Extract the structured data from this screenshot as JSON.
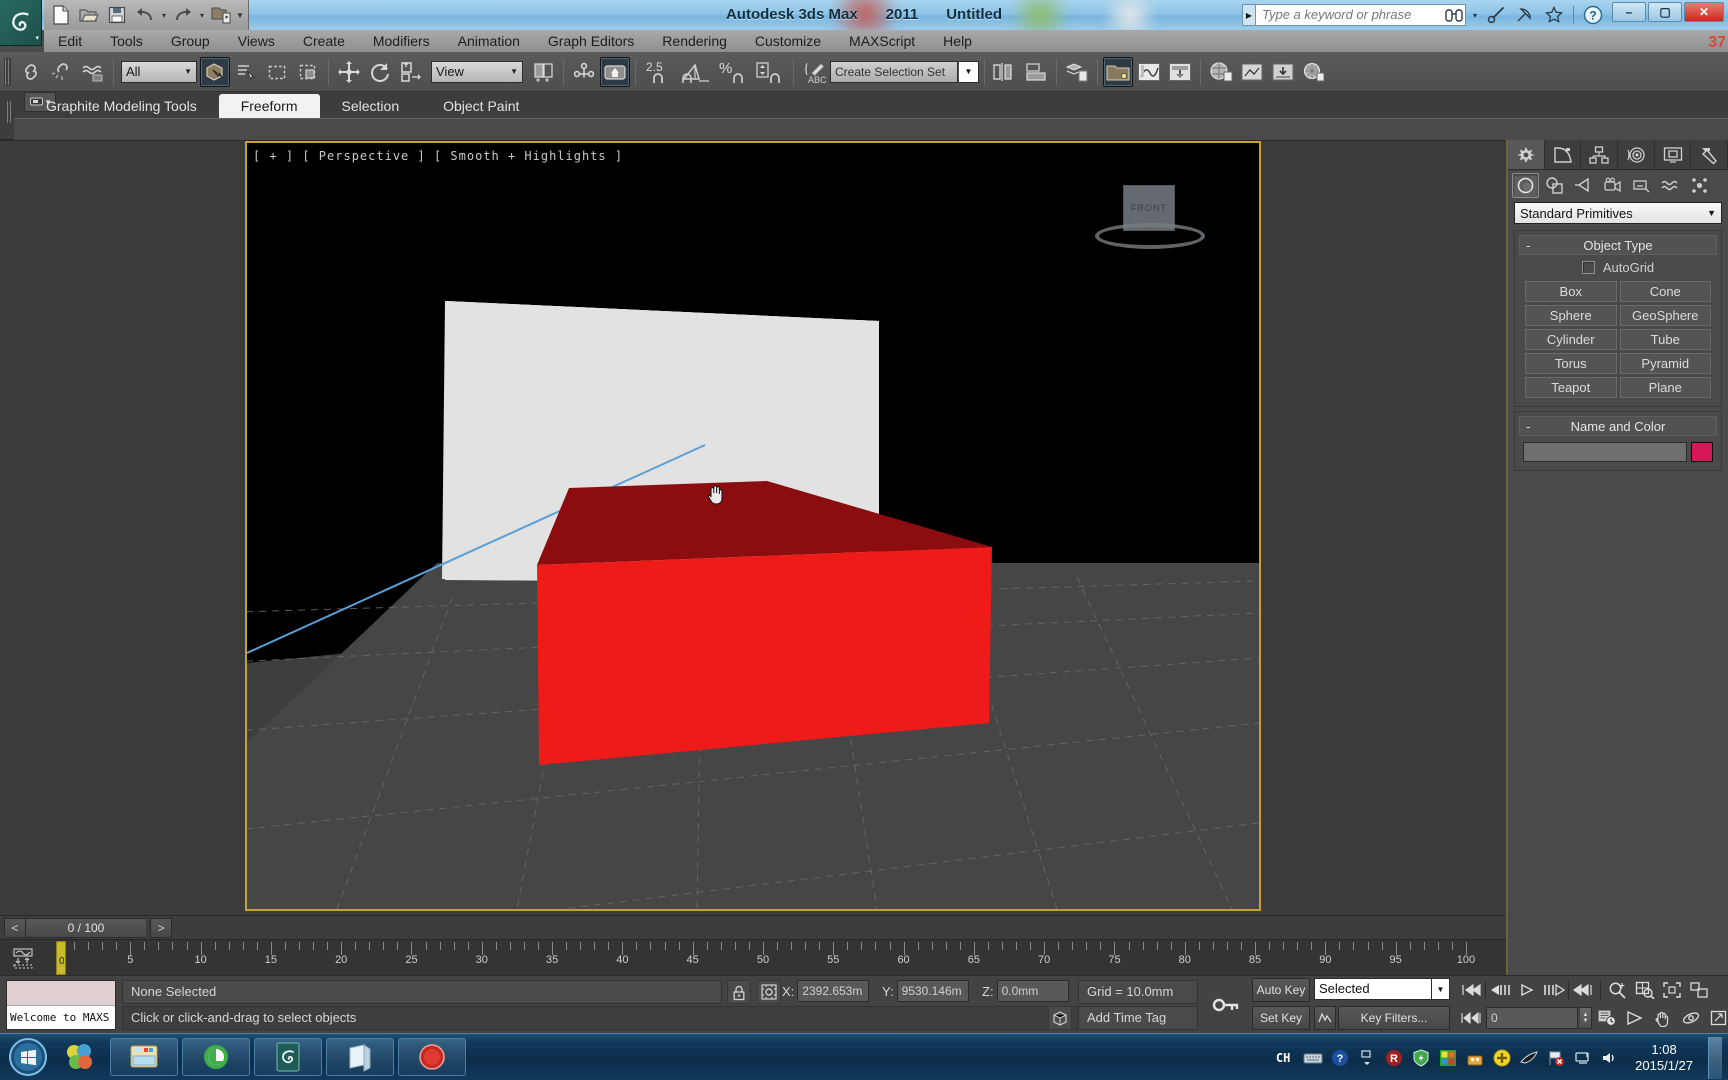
{
  "window": {
    "app_name": "Autodesk 3ds Max",
    "version": "2011",
    "document": "Untitled",
    "minimize_label": "–",
    "maximize_label": "▢",
    "close_label": "✕"
  },
  "quick_access": {
    "items": [
      {
        "name": "new-file-icon",
        "label": "New"
      },
      {
        "name": "open-file-icon",
        "label": "Open"
      },
      {
        "name": "save-file-icon",
        "label": "Save"
      },
      {
        "name": "undo-icon",
        "label": "Undo"
      },
      {
        "name": "undo-dropdown-icon",
        "label": "▾"
      },
      {
        "name": "redo-icon",
        "label": "Redo"
      },
      {
        "name": "redo-dropdown-icon",
        "label": "▾"
      },
      {
        "name": "project-folder-icon",
        "label": "Set Project Folder"
      },
      {
        "name": "qat-customize-icon",
        "label": "▾"
      }
    ]
  },
  "search": {
    "placeholder": "Type a keyword or phrase",
    "expand_label": "▶"
  },
  "title_icons": [
    {
      "name": "binoculars-icon",
      "label": "Search"
    },
    {
      "name": "binoculars-dropdown-icon",
      "label": "▾"
    },
    {
      "name": "key-wrench-icon",
      "label": "Subscription"
    },
    {
      "name": "satellite-dish-icon",
      "label": "Communication Center"
    },
    {
      "name": "favorites-star-icon",
      "label": "Favorites"
    },
    {
      "name": "help-question-icon",
      "label": "Help"
    }
  ],
  "menubar": {
    "items": [
      {
        "label": "Edit"
      },
      {
        "label": "Tools"
      },
      {
        "label": "Group"
      },
      {
        "label": "Views"
      },
      {
        "label": "Create"
      },
      {
        "label": "Modifiers"
      },
      {
        "label": "Animation"
      },
      {
        "label": "Graph Editors"
      },
      {
        "label": "Rendering"
      },
      {
        "label": "Customize"
      },
      {
        "label": "MAXScript"
      },
      {
        "label": "Help"
      }
    ]
  },
  "toolbar": {
    "selection_filter": "All",
    "reference_coord_system": "View",
    "named_selection_set": "Create Selection Set",
    "snap_angle": "2.5",
    "buttons": [
      {
        "name": "select-and-link-icon",
        "label": "Select and Link",
        "active": false
      },
      {
        "name": "unlink-selection-icon",
        "label": "Unlink Selection",
        "active": false
      },
      {
        "name": "bind-to-space-warp-icon",
        "label": "Bind to Space Warp",
        "active": false
      },
      {
        "name": "select-object-icon",
        "label": "Select Object",
        "active": true
      },
      {
        "name": "select-by-name-icon",
        "label": "Select by Name",
        "active": false
      },
      {
        "name": "rectangular-selection-region-icon",
        "label": "Rectangular Selection Region",
        "active": false
      },
      {
        "name": "window-crossing-icon",
        "label": "Window / Crossing",
        "active": false
      },
      {
        "name": "select-and-move-icon",
        "label": "Select and Move",
        "active": false
      },
      {
        "name": "select-and-rotate-icon",
        "label": "Select and Rotate",
        "active": false
      },
      {
        "name": "select-and-scale-icon",
        "label": "Select and Uniform Scale",
        "active": false
      },
      {
        "name": "use-center-flyout-icon",
        "label": "Use Pivot Point Center",
        "active": false
      },
      {
        "name": "select-and-manipulate-icon",
        "label": "Select and Manipulate",
        "active": true
      },
      {
        "name": "snaps-toggle-icon",
        "label": "Snaps Toggle",
        "active": false
      },
      {
        "name": "angle-snap-toggle-icon",
        "label": "Angle Snap Toggle",
        "active": false
      },
      {
        "name": "percent-snap-toggle-icon",
        "label": "Percent Snap Toggle",
        "active": false
      },
      {
        "name": "spinner-snap-toggle-icon",
        "label": "Spinner Snap Toggle",
        "active": false
      },
      {
        "name": "edit-named-selection-sets-icon",
        "label": "Edit Named Selection Sets",
        "active": false
      },
      {
        "name": "mirror-icon",
        "label": "Mirror",
        "active": false
      },
      {
        "name": "align-icon",
        "label": "Align",
        "active": false
      },
      {
        "name": "layer-manager-icon",
        "label": "Layer Manager",
        "active": false
      },
      {
        "name": "graphite-modeling-toggle-icon",
        "label": "Toggle Ribbon",
        "active": true
      },
      {
        "name": "curve-editor-icon",
        "label": "Curve Editor",
        "active": false
      },
      {
        "name": "schematic-view-icon",
        "label": "Schematic View",
        "active": false
      },
      {
        "name": "material-editor-icon",
        "label": "Material Editor",
        "active": false
      },
      {
        "name": "render-setup-icon",
        "label": "Render Setup",
        "active": false
      },
      {
        "name": "rendered-frame-window-icon",
        "label": "Rendered Frame Window",
        "active": false
      },
      {
        "name": "render-production-icon",
        "label": "Render Production",
        "active": false
      }
    ]
  },
  "ribbon": {
    "tabs": [
      {
        "label": "Graphite Modeling Tools",
        "active": false
      },
      {
        "label": "Freeform",
        "active": true
      },
      {
        "label": "Selection",
        "active": false
      },
      {
        "label": "Object Paint",
        "active": false
      }
    ],
    "minimize_label": "▾"
  },
  "viewport": {
    "label": "[ + ] [ Perspective ] [ Smooth + Highlights ]",
    "viewcube_face": "FRONT",
    "object_color_top": "#8b0d10",
    "object_color_front": "#ee1b18",
    "backdrop_color": "#e2e2e2",
    "grid_color": "#6a6a6a",
    "border_color": "#c6a22b",
    "gizmo_line_color": "#5b9fd6"
  },
  "time_slider": {
    "prev_label": "<",
    "next_label": ">",
    "current": "0 / 100"
  },
  "track_bar": {
    "ticks": [
      "5",
      "10",
      "15",
      "20",
      "25",
      "30",
      "35",
      "40",
      "45",
      "50",
      "55",
      "60",
      "65",
      "70",
      "75",
      "80",
      "85",
      "90",
      "95",
      "100"
    ],
    "playhead_label": "0"
  },
  "maxscript_listener": {
    "text": "Welcome to MAXS"
  },
  "status": {
    "selection": "None Selected",
    "prompt": "Click or click-and-drag to select objects",
    "lock_icon": "lock-selection-icon",
    "absolute_mode_icon": "absolute-relative-transform-icon",
    "x_label": "X:",
    "x_value": "2392.653m",
    "y_label": "Y:",
    "y_value": "9530.146m",
    "z_label": "Z:",
    "z_value": "0.0mm",
    "grid": "Grid = 10.0mm",
    "add_time_tag": "Add Time Tag",
    "key_mode_icon": "key-mode-toggle-icon"
  },
  "animation": {
    "auto_key": "Auto Key",
    "set_key": "Set Key",
    "key_filters": "Key Filters...",
    "selection_level": "Selected",
    "frame_value": "0",
    "transport": [
      {
        "name": "go-to-start-icon",
        "label": "Go to Start"
      },
      {
        "name": "previous-frame-icon",
        "label": "Previous Frame"
      },
      {
        "name": "play-animation-icon",
        "label": "Play Animation"
      },
      {
        "name": "next-frame-icon",
        "label": "Next Frame"
      },
      {
        "name": "go-to-end-icon",
        "label": "Go to End"
      }
    ],
    "key_nav_icon": "key-mode-nav-icon",
    "time-configuration-icon": "time-configuration-icon"
  },
  "viewport_nav": [
    {
      "name": "zoom-icon",
      "label": "Zoom"
    },
    {
      "name": "zoom-all-icon",
      "label": "Zoom All"
    },
    {
      "name": "zoom-extents-icon",
      "label": "Zoom Extents"
    },
    {
      "name": "zoom-region-icon",
      "label": "Zoom Region"
    },
    {
      "name": "field-of-view-icon",
      "label": "Field of View"
    },
    {
      "name": "pan-view-icon",
      "label": "Pan View"
    },
    {
      "name": "orbit-icon",
      "label": "Orbit"
    },
    {
      "name": "maximize-viewport-icon",
      "label": "Maximize Viewport Toggle"
    }
  ],
  "command_panel": {
    "tabs": [
      {
        "name": "create-tab-icon",
        "label": "Create",
        "active": true
      },
      {
        "name": "modify-tab-icon",
        "label": "Modify",
        "active": false
      },
      {
        "name": "hierarchy-tab-icon",
        "label": "Hierarchy",
        "active": false
      },
      {
        "name": "motion-tab-icon",
        "label": "Motion",
        "active": false
      },
      {
        "name": "display-tab-icon",
        "label": "Display",
        "active": false
      },
      {
        "name": "utilities-tab-icon",
        "label": "Utilities",
        "active": false
      }
    ],
    "subtabs": [
      {
        "name": "geometry-icon",
        "label": "Geometry",
        "active": true
      },
      {
        "name": "shapes-icon",
        "label": "Shapes",
        "active": false
      },
      {
        "name": "lights-icon",
        "label": "Lights",
        "active": false
      },
      {
        "name": "cameras-icon",
        "label": "Cameras",
        "active": false
      },
      {
        "name": "helpers-icon",
        "label": "Helpers",
        "active": false
      },
      {
        "name": "space-warps-icon",
        "label": "Space Warps",
        "active": false
      },
      {
        "name": "systems-icon",
        "label": "Systems",
        "active": false
      }
    ],
    "category": "Standard Primitives",
    "category_arrow": "▼",
    "object_type": {
      "title": "Object Type",
      "collapse": "-",
      "autogrid": "AutoGrid",
      "buttons": [
        "Box",
        "Cone",
        "Sphere",
        "GeoSphere",
        "Cylinder",
        "Tube",
        "Torus",
        "Pyramid",
        "Teapot",
        "Plane"
      ]
    },
    "name_and_color": {
      "title": "Name and Color",
      "collapse": "-",
      "name_value": "",
      "color": "#d6185a"
    }
  },
  "taskbar": {
    "start_label": "Start",
    "quick_launch": [
      {
        "name": "show-desktop-icon",
        "label": "Show Desktop"
      }
    ],
    "tasks": [
      {
        "name": "windows-explorer-task",
        "label": "Windows Explorer"
      },
      {
        "name": "browser-task",
        "label": "Browser"
      },
      {
        "name": "3dsmax-task",
        "label": "Autodesk 3ds Max 2011"
      },
      {
        "name": "notepad-task",
        "label": "Notepad"
      },
      {
        "name": "recorder-task",
        "label": "Screen Recorder"
      }
    ],
    "tray": [
      {
        "name": "ime-indicator",
        "label": "CH"
      },
      {
        "name": "keyboard-icon",
        "label": "Keyboard"
      },
      {
        "name": "help-icon",
        "label": "Help"
      },
      {
        "name": "show-hidden-icons-icon",
        "label": "▴"
      },
      {
        "name": "r-antivirus-icon",
        "label": "R"
      },
      {
        "name": "shield-security-icon",
        "label": "Security"
      },
      {
        "name": "green-grid-icon",
        "label": "Grid App"
      },
      {
        "name": "download-manager-icon",
        "label": "Download Manager"
      },
      {
        "name": "update-icon",
        "label": "Update"
      },
      {
        "name": "pen-tool-icon",
        "label": "Pen Tool"
      },
      {
        "name": "flag-action-center-icon",
        "label": "Action Center"
      },
      {
        "name": "network-icon",
        "label": "Network"
      },
      {
        "name": "volume-icon",
        "label": "Volume"
      }
    ],
    "clock_time": "1:08",
    "clock_date": "2015/1/27"
  },
  "overlay": {
    "badge": "37"
  }
}
